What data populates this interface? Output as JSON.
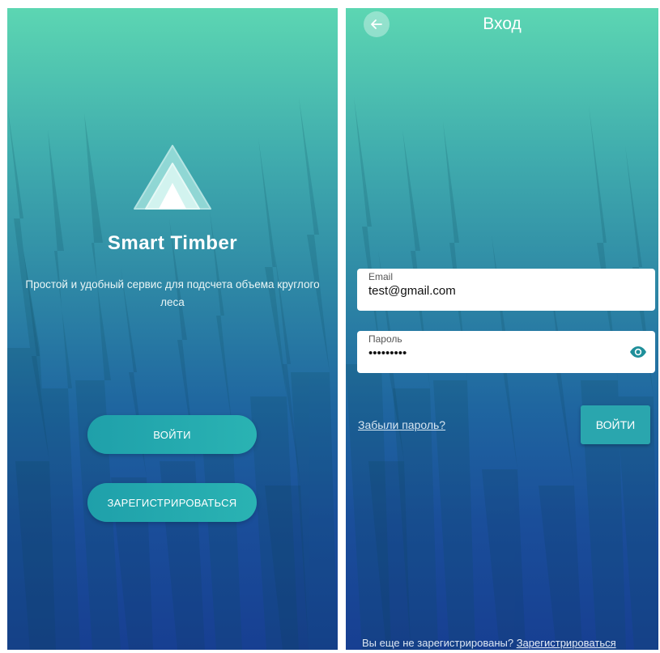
{
  "welcome": {
    "app_title": "Smart Timber",
    "subtitle": "Простой и удобный сервис для подсчета объема круглого леса",
    "login_button": "ВОЙТИ",
    "register_button": "ЗАРЕГИСТРИРОВАТЬСЯ",
    "logo_icon": "layered-triangle-logo-icon"
  },
  "login": {
    "title": "Вход",
    "back_icon": "arrow-left-icon",
    "email_label": "Email",
    "email_value": "test@gmail.com",
    "password_label": "Пароль",
    "password_value": "•••••••••",
    "eye_icon": "eye-icon",
    "forgot_link": "Забыли пароль?",
    "login_button": "ВОЙТИ",
    "no_account_text": "Вы еще не зарегистрированы?",
    "register_link": "Зарегистрироваться"
  },
  "colors": {
    "gradient_top": "#5cd6b2",
    "gradient_bottom": "#173f92",
    "button": "#2aa6ae",
    "eye_icon": "#1f8f9a"
  }
}
